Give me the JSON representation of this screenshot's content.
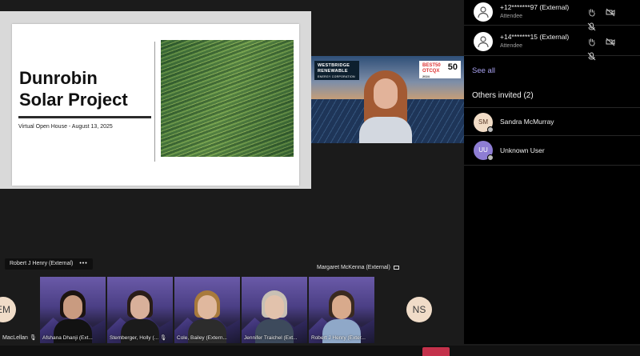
{
  "slide": {
    "title_line1": "Dunrobin",
    "title_line2": "Solar Project",
    "subtitle": "Virtual Open House - August 13, 2025"
  },
  "speaker_tile": {
    "logo_line1": "WESTBRIDGE",
    "logo_line2": "RENEWABLE",
    "logo_line3": "ENERGY CORPORATION",
    "badge_text": "BEST50 OTCQX",
    "badge_number": "50",
    "badge_year": "2024"
  },
  "name_plates": {
    "presenter": "Robert J Henry (External)",
    "more": "•••",
    "speaker": "Margaret McKenna (External)"
  },
  "participants": {
    "em_initials": "EM",
    "em_name": "MacLellan",
    "ns_initials": "NS",
    "tiles": [
      {
        "name": "Afshana Dhanji (Ext..."
      },
      {
        "name": "Stemberger, Holly (..."
      },
      {
        "name": "Cole, Bailey (Extern..."
      },
      {
        "name": "Jennifer Traichel (Ext..."
      },
      {
        "name": "Robert J Henry (Exter..."
      }
    ]
  },
  "panel": {
    "attendees": [
      {
        "name": "+12*******97 (External)",
        "role": "Attendee"
      },
      {
        "name": "+14*******15 (External)",
        "role": "Attendee"
      }
    ],
    "see_all": "See all",
    "others_invited": "Others invited (2)",
    "invited": [
      {
        "initials": "SM",
        "name": "Sandra McMurray"
      },
      {
        "initials": "UU",
        "name": "Unknown User"
      }
    ]
  },
  "colors": {
    "panel_bg": "#000000",
    "link": "#a9a2f0",
    "leave": "#c4314b"
  }
}
